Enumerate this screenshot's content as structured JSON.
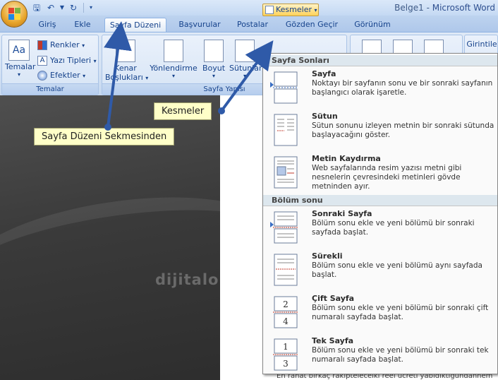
{
  "window": {
    "title_doc": "Belge1",
    "title_sep": " - ",
    "title_app": "Microsoft Word"
  },
  "tabs": [
    {
      "label": "Giriş"
    },
    {
      "label": "Ekle"
    },
    {
      "label": "Sayfa Düzeni",
      "active": true
    },
    {
      "label": "Başvurular"
    },
    {
      "label": "Postalar"
    },
    {
      "label": "Gözden Geçir"
    },
    {
      "label": "Görünüm"
    }
  ],
  "ribbon": {
    "temalar_group": {
      "label": "Temalar",
      "temalar_btn": "Temalar",
      "renkler": "Renkler",
      "yazi_tipleri": "Yazı Tipleri",
      "efektler": "Efektler"
    },
    "sayfa_yapisi_group": {
      "label": "Sayfa Yapısı",
      "kenar_line1": "Kenar",
      "kenar_line2": "Boşlukları",
      "yonlendirme": "Yönlendirme",
      "boyut": "Boyut",
      "sutunlar": "Sütunlar",
      "kesmeler": "Kesmeler"
    },
    "girintile": "Girintile"
  },
  "menu": {
    "section1": "Sayfa Sonları",
    "section2": "Bölüm sonu",
    "items": [
      {
        "title": "Sayfa",
        "desc": "Noktayı bir sayfanın sonu ve bir sonraki sayfanın başlangıcı olarak işaretle."
      },
      {
        "title": "Sütun",
        "desc": "Sütun sonunu izleyen metnin bir sonraki sütunda başlayacağını göster."
      },
      {
        "title": "Metin Kaydırma",
        "desc": "Web sayfalarında resim yazısı metni gibi nesnelerin çevresindeki metinleri gövde metninden ayır."
      },
      {
        "title": "Sonraki Sayfa",
        "desc": "Bölüm sonu ekle ve yeni bölümü bir sonraki sayfada başlat."
      },
      {
        "title": "Sürekli",
        "desc": "Bölüm sonu ekle ve yeni bölümü aynı sayfada başlat."
      },
      {
        "title": "Çift Sayfa",
        "desc": "Bölüm sonu ekle ve yeni bölümü bir sonraki çift numaralı sayfada başlat."
      },
      {
        "title": "Tek Sayfa",
        "desc": "Bölüm sonu ekle ve yeni bölümü bir sonraki tek numaralı sayfada başlat."
      }
    ],
    "cift_icon_number": "2",
    "cift_icon_number2": "4",
    "tek_icon_number": "1",
    "tek_icon_number2": "3"
  },
  "callouts": {
    "kesmeler": "Kesmeler",
    "sayfa_duzeni": "Sayfa Düzeni Sekmesinden"
  },
  "watermark": "dijitalo",
  "bottom_text": "En rahat birkaç rakiptelecelki reel ücreti yabidiktigundannem",
  "colors": {
    "arrow": "#2f5aa8",
    "callout_bg": "#ffffc8",
    "accent": "#ffd25a"
  }
}
